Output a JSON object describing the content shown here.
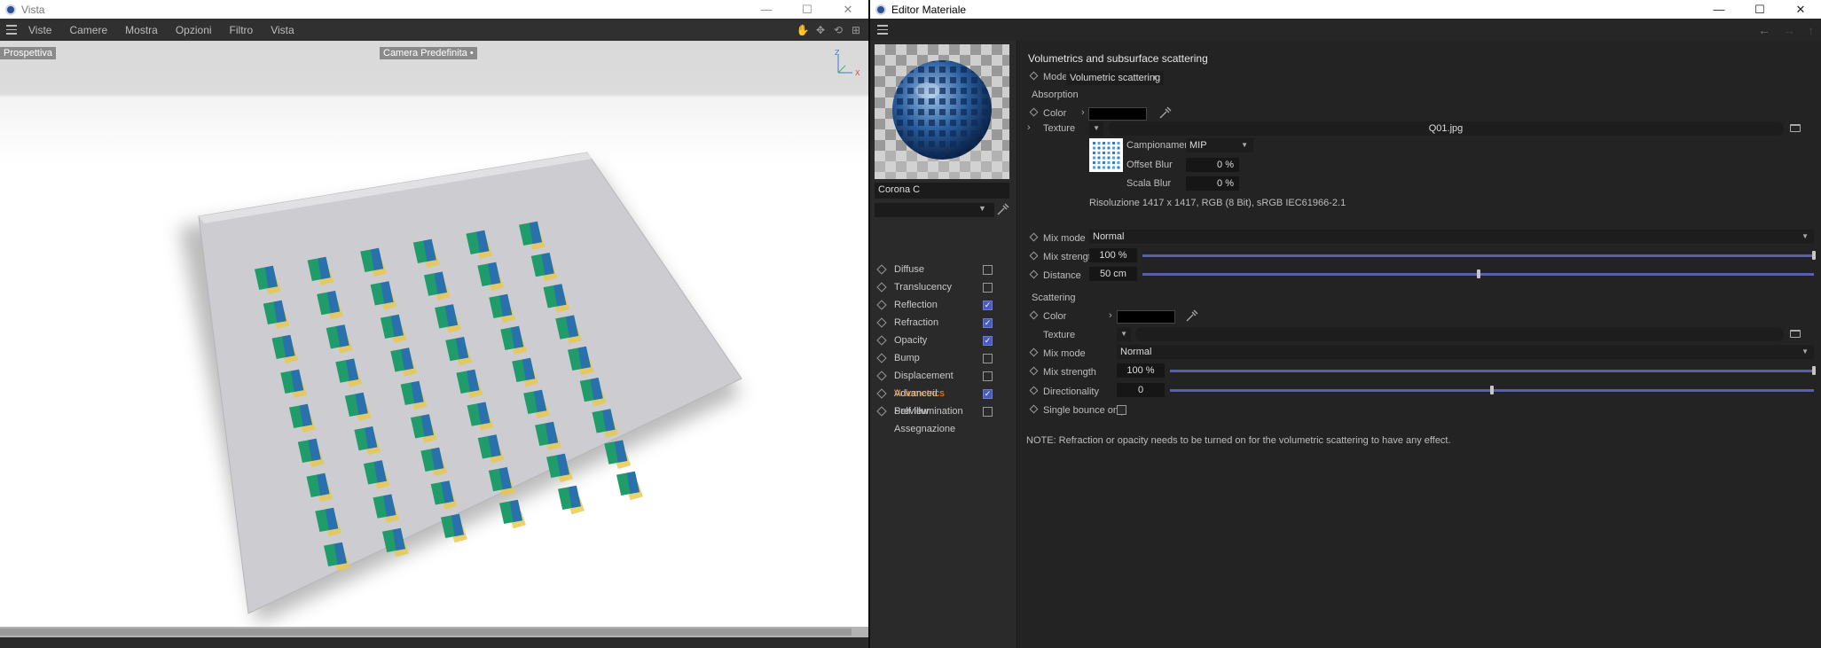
{
  "viewport_window": {
    "title": "Vista",
    "controls": {
      "minimize": "—",
      "maximize": "☐",
      "close": "✕"
    },
    "menu": [
      "Viste",
      "Camere",
      "Mostra",
      "Opzioni",
      "Filtro",
      "Vista"
    ],
    "view_label": "Prospettiva",
    "camera_label": "Camera Predefinita",
    "camera_suffix": "•",
    "axis": {
      "z": "Z",
      "y": "Y",
      "x": "X"
    },
    "nav_icons": [
      "hand-icon",
      "move-icon",
      "rotate-icon",
      "layout-icon"
    ]
  },
  "material_editor": {
    "title": "Editor Materiale",
    "controls": {
      "minimize": "—",
      "maximize": "☐",
      "close": "✕"
    },
    "material_name": "Corona C",
    "channels": [
      {
        "label": "Diffuse",
        "checked": false,
        "active": false
      },
      {
        "label": "Translucency",
        "checked": false,
        "active": false
      },
      {
        "label": "Reflection",
        "checked": true,
        "active": false
      },
      {
        "label": "Refraction",
        "checked": true,
        "active": false
      },
      {
        "label": "Opacity",
        "checked": true,
        "active": false
      },
      {
        "label": "Bump",
        "checked": false,
        "active": false
      },
      {
        "label": "Displacement",
        "checked": false,
        "active": false
      },
      {
        "label": "Volumetrics",
        "checked": true,
        "active": true
      },
      {
        "label": "Self Illumination",
        "checked": false,
        "active": false
      }
    ],
    "links": [
      "Advanced",
      "Preview",
      "Assegnazione"
    ],
    "panel": {
      "title": "Volumetrics and subsurface scattering",
      "mode_label": "Mode",
      "mode_value": "Volumetric scattering",
      "absorption": {
        "heading": "Absorption",
        "color_label": "Color",
        "texture_label": "Texture",
        "texture_file": "Q01.jpg",
        "campionamento_label": "Campionamento",
        "campionamento_value": "MIP",
        "offset_blur_label": "Offset Blur",
        "offset_blur_value": "0 %",
        "scala_blur_label": "Scala Blur",
        "scala_blur_value": "0 %",
        "resolution_text": "Risoluzione 1417 x 1417, RGB (8 Bit), sRGB IEC61966-2.1",
        "mix_mode_label": "Mix mode",
        "mix_mode_value": "Normal",
        "mix_strength_label": "Mix strength",
        "mix_strength_value": "100 %",
        "mix_strength_fraction": 1.0,
        "distance_label": "Distance",
        "distance_value": "50 cm",
        "distance_fraction": 0.5
      },
      "scattering": {
        "heading": "Scattering",
        "color_label": "Color",
        "texture_label": "Texture",
        "mix_mode_label": "Mix mode",
        "mix_mode_value": "Normal",
        "mix_strength_label": "Mix strength",
        "mix_strength_value": "100 %",
        "mix_strength_fraction": 1.0,
        "directionality_label": "Directionality",
        "directionality_value": "0",
        "directionality_fraction": 0.5,
        "single_bounce_label": "Single bounce only",
        "single_bounce_checked": false
      },
      "note": "NOTE: Refraction or opacity needs to be turned on for the volumetric scattering to have any effect."
    }
  },
  "colors": {
    "accent_slider": "#5b5ea8",
    "checkbox_on": "#4a5bbf",
    "active_channel": "#ff8a1a",
    "tile_green": "#1f9c6a",
    "tile_blue": "#2c68b8",
    "tile_yellow": "#e8c84a"
  }
}
